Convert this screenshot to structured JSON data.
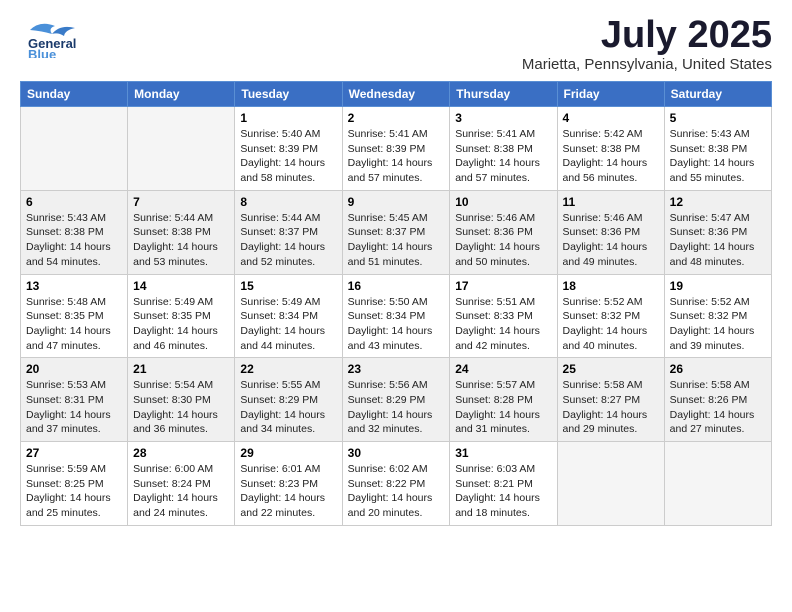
{
  "logo": {
    "line1": "General",
    "line2": "Blue"
  },
  "title": "July 2025",
  "subtitle": "Marietta, Pennsylvania, United States",
  "days": [
    "Sunday",
    "Monday",
    "Tuesday",
    "Wednesday",
    "Thursday",
    "Friday",
    "Saturday"
  ],
  "weeks": [
    [
      {
        "day": "",
        "content": ""
      },
      {
        "day": "",
        "content": ""
      },
      {
        "day": "1",
        "content": "Sunrise: 5:40 AM\nSunset: 8:39 PM\nDaylight: 14 hours\nand 58 minutes."
      },
      {
        "day": "2",
        "content": "Sunrise: 5:41 AM\nSunset: 8:39 PM\nDaylight: 14 hours\nand 57 minutes."
      },
      {
        "day": "3",
        "content": "Sunrise: 5:41 AM\nSunset: 8:38 PM\nDaylight: 14 hours\nand 57 minutes."
      },
      {
        "day": "4",
        "content": "Sunrise: 5:42 AM\nSunset: 8:38 PM\nDaylight: 14 hours\nand 56 minutes."
      },
      {
        "day": "5",
        "content": "Sunrise: 5:43 AM\nSunset: 8:38 PM\nDaylight: 14 hours\nand 55 minutes."
      }
    ],
    [
      {
        "day": "6",
        "content": "Sunrise: 5:43 AM\nSunset: 8:38 PM\nDaylight: 14 hours\nand 54 minutes."
      },
      {
        "day": "7",
        "content": "Sunrise: 5:44 AM\nSunset: 8:38 PM\nDaylight: 14 hours\nand 53 minutes."
      },
      {
        "day": "8",
        "content": "Sunrise: 5:44 AM\nSunset: 8:37 PM\nDaylight: 14 hours\nand 52 minutes."
      },
      {
        "day": "9",
        "content": "Sunrise: 5:45 AM\nSunset: 8:37 PM\nDaylight: 14 hours\nand 51 minutes."
      },
      {
        "day": "10",
        "content": "Sunrise: 5:46 AM\nSunset: 8:36 PM\nDaylight: 14 hours\nand 50 minutes."
      },
      {
        "day": "11",
        "content": "Sunrise: 5:46 AM\nSunset: 8:36 PM\nDaylight: 14 hours\nand 49 minutes."
      },
      {
        "day": "12",
        "content": "Sunrise: 5:47 AM\nSunset: 8:36 PM\nDaylight: 14 hours\nand 48 minutes."
      }
    ],
    [
      {
        "day": "13",
        "content": "Sunrise: 5:48 AM\nSunset: 8:35 PM\nDaylight: 14 hours\nand 47 minutes."
      },
      {
        "day": "14",
        "content": "Sunrise: 5:49 AM\nSunset: 8:35 PM\nDaylight: 14 hours\nand 46 minutes."
      },
      {
        "day": "15",
        "content": "Sunrise: 5:49 AM\nSunset: 8:34 PM\nDaylight: 14 hours\nand 44 minutes."
      },
      {
        "day": "16",
        "content": "Sunrise: 5:50 AM\nSunset: 8:34 PM\nDaylight: 14 hours\nand 43 minutes."
      },
      {
        "day": "17",
        "content": "Sunrise: 5:51 AM\nSunset: 8:33 PM\nDaylight: 14 hours\nand 42 minutes."
      },
      {
        "day": "18",
        "content": "Sunrise: 5:52 AM\nSunset: 8:32 PM\nDaylight: 14 hours\nand 40 minutes."
      },
      {
        "day": "19",
        "content": "Sunrise: 5:52 AM\nSunset: 8:32 PM\nDaylight: 14 hours\nand 39 minutes."
      }
    ],
    [
      {
        "day": "20",
        "content": "Sunrise: 5:53 AM\nSunset: 8:31 PM\nDaylight: 14 hours\nand 37 minutes."
      },
      {
        "day": "21",
        "content": "Sunrise: 5:54 AM\nSunset: 8:30 PM\nDaylight: 14 hours\nand 36 minutes."
      },
      {
        "day": "22",
        "content": "Sunrise: 5:55 AM\nSunset: 8:29 PM\nDaylight: 14 hours\nand 34 minutes."
      },
      {
        "day": "23",
        "content": "Sunrise: 5:56 AM\nSunset: 8:29 PM\nDaylight: 14 hours\nand 32 minutes."
      },
      {
        "day": "24",
        "content": "Sunrise: 5:57 AM\nSunset: 8:28 PM\nDaylight: 14 hours\nand 31 minutes."
      },
      {
        "day": "25",
        "content": "Sunrise: 5:58 AM\nSunset: 8:27 PM\nDaylight: 14 hours\nand 29 minutes."
      },
      {
        "day": "26",
        "content": "Sunrise: 5:58 AM\nSunset: 8:26 PM\nDaylight: 14 hours\nand 27 minutes."
      }
    ],
    [
      {
        "day": "27",
        "content": "Sunrise: 5:59 AM\nSunset: 8:25 PM\nDaylight: 14 hours\nand 25 minutes."
      },
      {
        "day": "28",
        "content": "Sunrise: 6:00 AM\nSunset: 8:24 PM\nDaylight: 14 hours\nand 24 minutes."
      },
      {
        "day": "29",
        "content": "Sunrise: 6:01 AM\nSunset: 8:23 PM\nDaylight: 14 hours\nand 22 minutes."
      },
      {
        "day": "30",
        "content": "Sunrise: 6:02 AM\nSunset: 8:22 PM\nDaylight: 14 hours\nand 20 minutes."
      },
      {
        "day": "31",
        "content": "Sunrise: 6:03 AM\nSunset: 8:21 PM\nDaylight: 14 hours\nand 18 minutes."
      },
      {
        "day": "",
        "content": ""
      },
      {
        "day": "",
        "content": ""
      }
    ]
  ]
}
